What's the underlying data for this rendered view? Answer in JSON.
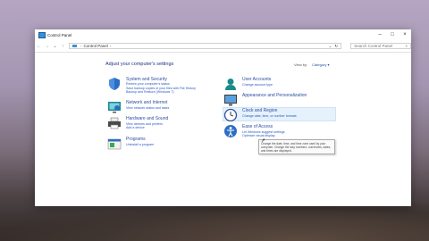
{
  "window": {
    "title": "Control Panel",
    "minimize": "–",
    "maximize": "□",
    "close": "×"
  },
  "address": {
    "back": "←",
    "forward": "→",
    "up_history": "⌄",
    "up": "↑",
    "crumb_root": "Control Panel",
    "crumb_sep": "›",
    "dropdown": "⌄",
    "refresh": "↻",
    "search_placeholder": "Search Control Panel",
    "search_icon": "⌕"
  },
  "main": {
    "heading": "Adjust your computer's settings",
    "view_by_label": "View by:",
    "view_by_value": "Category ▾"
  },
  "categories_left": [
    {
      "title": "System and Security",
      "links": [
        "Review your computer's status",
        "Save backup copies of your files with File History",
        "Backup and Restore (Windows 7)"
      ],
      "icon": "shield-icon"
    },
    {
      "title": "Network and Internet",
      "links": [
        "View network status and tasks"
      ],
      "icon": "network-icon"
    },
    {
      "title": "Hardware and Sound",
      "links": [
        "View devices and printers",
        "Add a device"
      ],
      "icon": "printer-icon"
    },
    {
      "title": "Programs",
      "links": [
        "Uninstall a program"
      ],
      "icon": "programs-icon"
    }
  ],
  "categories_right": [
    {
      "title": "User Accounts",
      "links": [
        "Change account type"
      ],
      "icon": "user-icon"
    },
    {
      "title": "Appearance and Personalization",
      "links": [],
      "icon": "appearance-icon"
    },
    {
      "title": "Clock and Region",
      "links": [
        "Change date, time, or number formats"
      ],
      "icon": "clock-icon"
    },
    {
      "title": "Ease of Access",
      "links": [
        "Let Windows suggest settings",
        "Optimize visual display"
      ],
      "icon": "ease-of-access-icon"
    }
  ],
  "tooltip": "Change the date, time, and time zone used by your computer. Change the way numbers, currencies, dates, and times are displayed.",
  "colors": {
    "link": "#2a56c6",
    "heading": "#1e3287",
    "icon_blue": "#2c6fc2",
    "icon_teal": "#1a8a8a"
  }
}
